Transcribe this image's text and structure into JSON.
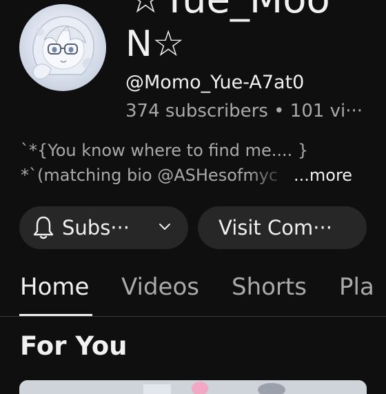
{
  "channel": {
    "name_line1": "☆Yue_Moo",
    "name_line2": "N☆",
    "handle": "@Momo_Yue-A7at0",
    "stats": "374 subscribers • 101 vi···"
  },
  "bio": {
    "line1": "`*{You know where to find me.... }",
    "line2": "*`(matching bio @ASHesofmyc",
    "more_label": "...more"
  },
  "buttons": {
    "subscribe_label": "Subs···",
    "visit_label": "Visit Com···"
  },
  "tabs": [
    {
      "label": "Home",
      "active": true
    },
    {
      "label": "Videos"
    },
    {
      "label": "Shorts"
    },
    {
      "label": "Pla"
    }
  ],
  "section": {
    "title": "For You"
  },
  "colors": {
    "background": "#0f0f0f",
    "button_bg": "#272727",
    "text_primary": "#f1f1f1",
    "text_secondary": "#aaaaaa"
  },
  "icons": {
    "bell": "bell-icon",
    "chevron": "chevron-down-icon"
  }
}
